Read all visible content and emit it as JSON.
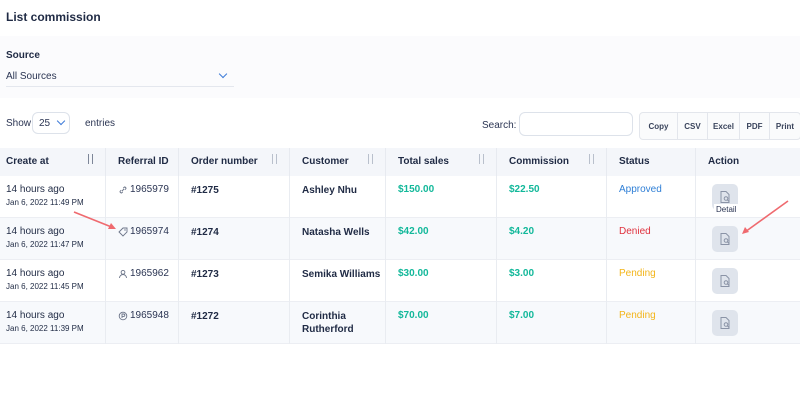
{
  "page": {
    "title": "List commission"
  },
  "filter": {
    "source_label": "Source",
    "source_value": "All Sources"
  },
  "toolbar": {
    "show_label": "Show",
    "entries_value": "25",
    "entries_label": "entries",
    "search_label": "Search:",
    "search_value": "",
    "exports": [
      "Copy",
      "CSV",
      "Excel",
      "PDF",
      "Print"
    ]
  },
  "table": {
    "headers": [
      "Create at",
      "Referral ID",
      "Order number",
      "Customer",
      "Total sales",
      "Commission",
      "Status",
      "Action"
    ],
    "rows": [
      {
        "time": "14 hours ago",
        "date": "Jan 6, 2022 11:49 PM",
        "ref_icon": "link-icon",
        "ref_id": "1965979",
        "order": "#1275",
        "customer": "Ashley Nhu",
        "total": "$150.00",
        "commission": "$22.50",
        "status": "Approved",
        "status_color": "#2f7fd6"
      },
      {
        "time": "14 hours ago",
        "date": "Jan 6, 2022 11:47 PM",
        "ref_icon": "tag-icon",
        "ref_id": "1965974",
        "order": "#1274",
        "customer": "Natasha Wells",
        "total": "$42.00",
        "commission": "$4.20",
        "status": "Denied",
        "status_color": "#e0313d"
      },
      {
        "time": "14 hours ago",
        "date": "Jan 6, 2022 11:45 PM",
        "ref_icon": "user-icon",
        "ref_id": "1965962",
        "order": "#1273",
        "customer": "Semika Williams",
        "total": "$30.00",
        "commission": "$3.00",
        "status": "Pending",
        "status_color": "#f3b51a"
      },
      {
        "time": "14 hours ago",
        "date": "Jan 6, 2022 11:39 PM",
        "ref_icon": "coupon-icon",
        "ref_id": "1965948",
        "order": "#1272",
        "customer": "Corinthia\nRutherford",
        "total": "$70.00",
        "commission": "$7.00",
        "status": "Pending",
        "status_color": "#f3b51a"
      }
    ]
  },
  "tooltip": {
    "text": "Detail"
  },
  "colors": {
    "accent": "#3e7bd8",
    "green": "#12b89a",
    "arrow": "#ef6a6f"
  }
}
